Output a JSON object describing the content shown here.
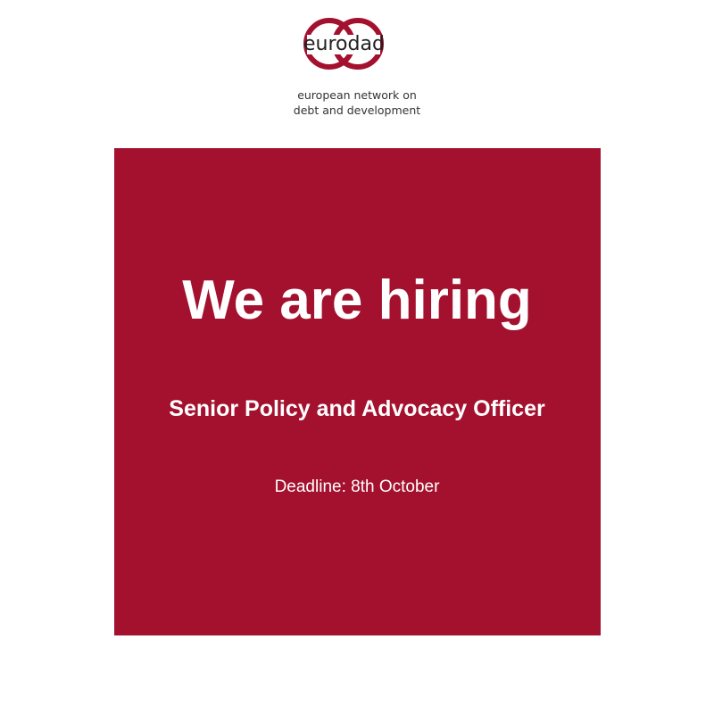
{
  "logo": {
    "wordmark": "eurodad",
    "tagline_line1": "european network on",
    "tagline_line2": "debt and development",
    "mark_color": "#a3112e"
  },
  "panel": {
    "background_color": "#a3112e",
    "headline": "We are hiring",
    "role": "Senior Policy and Advocacy Officer",
    "deadline": "Deadline: 8th October"
  }
}
